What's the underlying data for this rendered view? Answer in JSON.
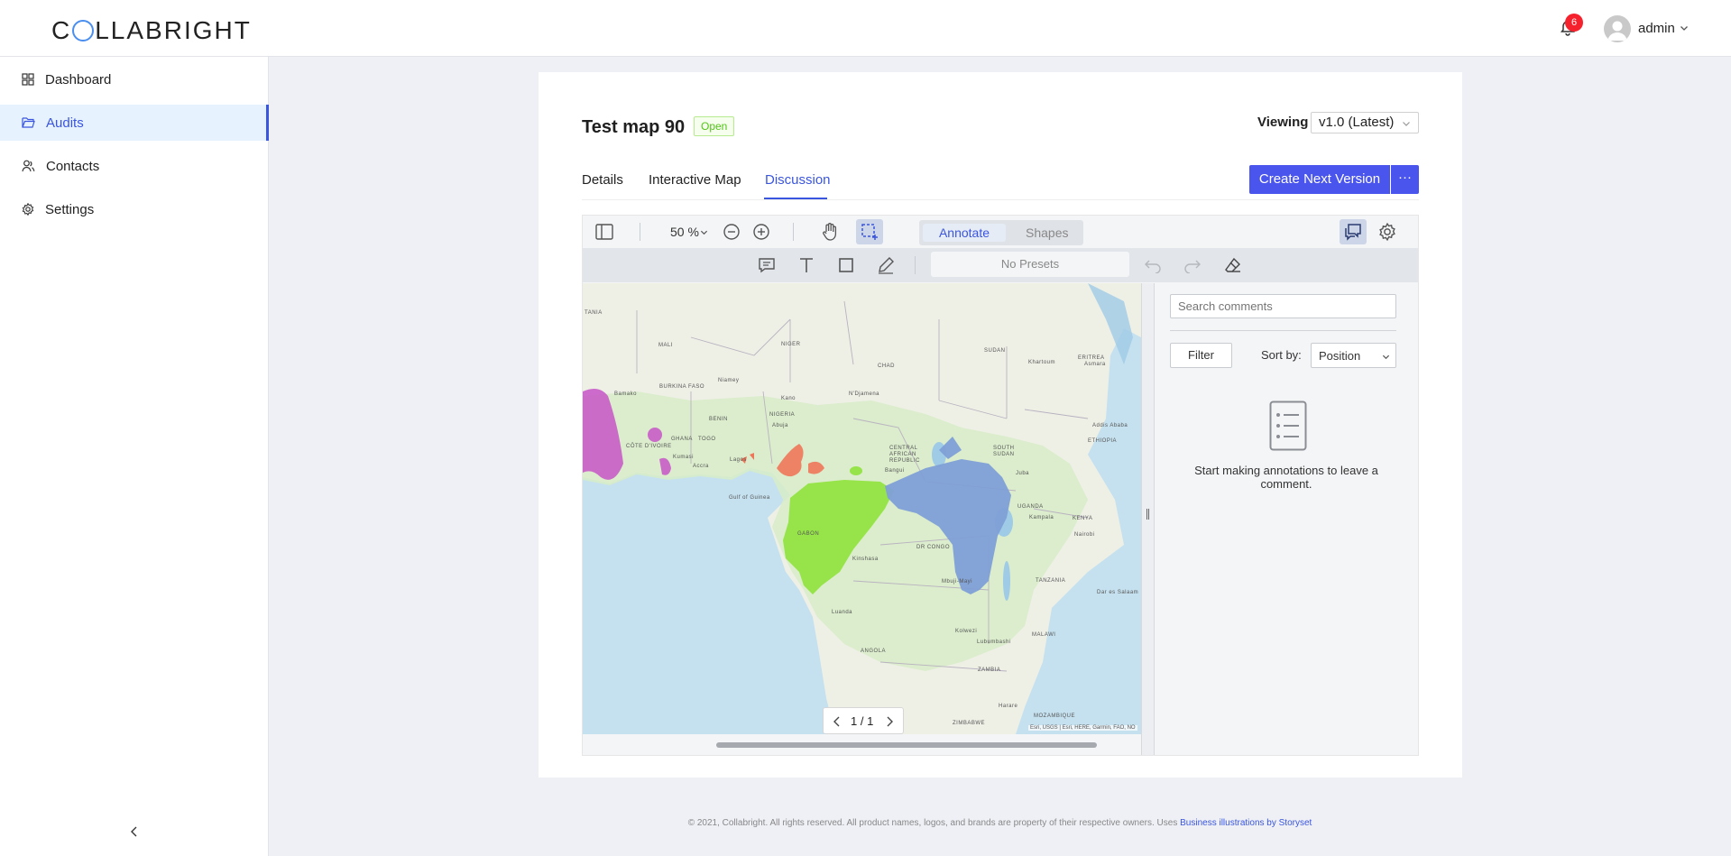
{
  "header": {
    "logo_text": "COLLABRIGHT",
    "notification_count": "6",
    "user_name": "admin"
  },
  "sidebar": {
    "items": [
      {
        "label": "Dashboard",
        "icon": "grid-icon"
      },
      {
        "label": "Audits",
        "icon": "folder-open-icon",
        "active": true
      },
      {
        "label": "Contacts",
        "icon": "contacts-icon"
      },
      {
        "label": "Settings",
        "icon": "gear-icon"
      }
    ]
  },
  "page": {
    "title": "Test map 90",
    "status": "Open",
    "viewing_label": "Viewing",
    "version": "v1.0 (Latest)",
    "tabs": [
      "Details",
      "Interactive Map",
      "Discussion"
    ],
    "active_tab": "Discussion",
    "create_button": "Create Next Version",
    "more_button": "···"
  },
  "viewer": {
    "zoom": "50 %",
    "modes": [
      "Annotate",
      "Shapes"
    ],
    "active_mode": "Annotate",
    "presets_placeholder": "No Presets",
    "page_indicator": "1 / 1",
    "attribution": "Esri, USGS | Esri, HERE, Garmin, FAO, NO",
    "map_labels": {
      "mali": "MALI",
      "niger": "NIGER",
      "chad": "CHAD",
      "sudan": "SUDAN",
      "khartoum": "Khartoum",
      "eritrea": "ERITREA",
      "nigeria": "NIGERIA",
      "south_sudan": "SOUTH SUDAN",
      "ethiopia": "ETHIOPIA",
      "car": "CENTRAL AFRICAN REPUBLIC",
      "dr_congo": "DR CONGO",
      "kenya": "KENYA",
      "tanzania": "TANZANIA",
      "angola": "ANGOLA",
      "zambia": "ZAMBIA",
      "malawi": "MALAWI",
      "mozambique": "MOZAMBIQUE",
      "zimbabwe": "ZIMBABWE",
      "ghana": "GHANA",
      "togo": "TOGO",
      "benin": "BENIN",
      "burkina": "BURKINA FASO",
      "cote": "CÔTE D'IVOIRE",
      "gulf": "Gulf of Guinea",
      "gabon": "GABON",
      "uganda": "UGANDA",
      "kinshasa": "Kinshasa",
      "luanda": "Luanda",
      "dar": "Dar es Salaam",
      "nairobi": "Nairobi",
      "lagos": "Lagos",
      "accra": "Accra",
      "niamey": "Niamey",
      "ndjamena": "N'Djamena",
      "addis": "Addis Ababa",
      "bamako": "Bamako",
      "kano": "Kano",
      "juba": "Juba",
      "kampala": "Kampala",
      "lubumbashi": "Lubumbashi",
      "kolwezi": "Kolwezi",
      "mbuji": "Mbuji-Mayi",
      "harare": "Harare",
      "tania": "TANIA",
      "abuja": "Abuja",
      "kumasi": "Kumasi",
      "bangui": "Bangui",
      "asmara": "Asmara"
    }
  },
  "comments": {
    "search_placeholder": "Search comments",
    "filter_label": "Filter",
    "sort_label": "Sort by:",
    "sort_value": "Position",
    "empty_text": "Start making annotations to leave a comment."
  },
  "footer": {
    "text": "© 2021, Collabright. All rights reserved. All product names, logos, and brands are property of their respective owners. Uses ",
    "link": "Business illustrations by Storyset"
  },
  "colors": {
    "accent": "#4a55ee",
    "active_nav": "#3a55e0",
    "open_tag": "#52c41a",
    "badge": "#f5222d",
    "region_magenta": "#c85cc8",
    "region_green": "#8fe23c",
    "region_blue": "#7f9fd6",
    "region_orange": "#f0765a"
  }
}
